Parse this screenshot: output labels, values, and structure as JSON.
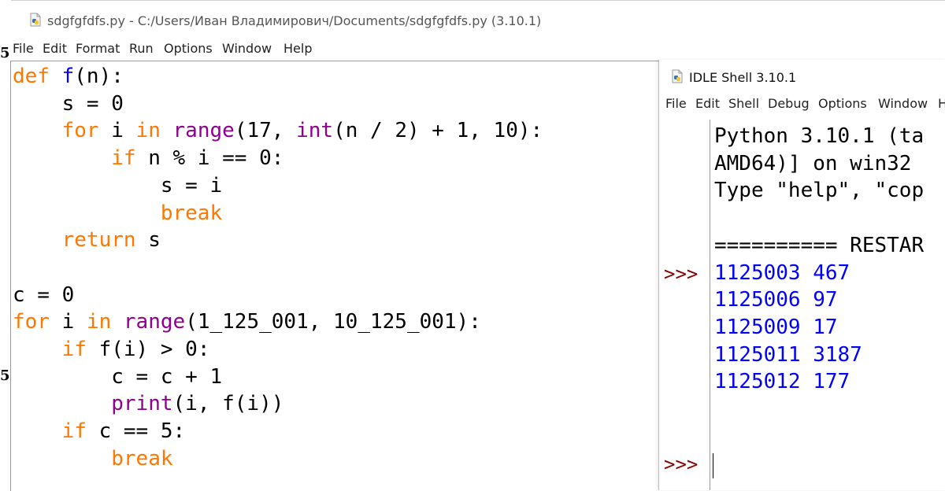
{
  "editor": {
    "title": "sdgfgfdfs.py - C:/Users/Иван Владимирович/Documents/sdgfgfdfs.py (3.10.1)",
    "menu": [
      "File",
      "Edit",
      "Format",
      "Run",
      "Options",
      "Window",
      "Help"
    ],
    "code_lines": [
      [
        {
          "t": "def",
          "c": "kw"
        },
        {
          "t": " "
        },
        {
          "t": "f",
          "c": "df"
        },
        {
          "t": "(n):"
        }
      ],
      [
        {
          "t": "    s = 0"
        }
      ],
      [
        {
          "t": "    "
        },
        {
          "t": "for",
          "c": "kw"
        },
        {
          "t": " i "
        },
        {
          "t": "in",
          "c": "kw"
        },
        {
          "t": " "
        },
        {
          "t": "range",
          "c": "bi"
        },
        {
          "t": "(17, "
        },
        {
          "t": "int",
          "c": "bi"
        },
        {
          "t": "(n / 2) + 1, 10):"
        }
      ],
      [
        {
          "t": "        "
        },
        {
          "t": "if",
          "c": "kw"
        },
        {
          "t": " n % i == 0:"
        }
      ],
      [
        {
          "t": "            s = i"
        }
      ],
      [
        {
          "t": "            "
        },
        {
          "t": "break",
          "c": "kw"
        }
      ],
      [
        {
          "t": "    "
        },
        {
          "t": "return",
          "c": "kw"
        },
        {
          "t": " s"
        }
      ],
      [
        {
          "t": ""
        }
      ],
      [
        {
          "t": "c = 0"
        }
      ],
      [
        {
          "t": "for",
          "c": "kw"
        },
        {
          "t": " i "
        },
        {
          "t": "in",
          "c": "kw"
        },
        {
          "t": " "
        },
        {
          "t": "range",
          "c": "bi"
        },
        {
          "t": "(1_125_001, 10_125_001):"
        }
      ],
      [
        {
          "t": "    "
        },
        {
          "t": "if",
          "c": "kw"
        },
        {
          "t": " f(i) > 0:"
        }
      ],
      [
        {
          "t": "        c = c + 1"
        }
      ],
      [
        {
          "t": "        "
        },
        {
          "t": "print",
          "c": "bi"
        },
        {
          "t": "(i, f(i))"
        }
      ],
      [
        {
          "t": "    "
        },
        {
          "t": "if",
          "c": "kw"
        },
        {
          "t": " c == 5:"
        }
      ],
      [
        {
          "t": "        "
        },
        {
          "t": "break",
          "c": "kw"
        }
      ]
    ],
    "edge_marks": [
      "5",
      "5"
    ]
  },
  "shell": {
    "title": "IDLE Shell 3.10.1",
    "menu": [
      "File",
      "Edit",
      "Shell",
      "Debug",
      "Options",
      "Window",
      "H"
    ],
    "prompt": ">>>",
    "lines": [
      {
        "text": "Python 3.10.1 (ta",
        "style": "plain"
      },
      {
        "text": "AMD64)] on win32",
        "style": "plain"
      },
      {
        "text": "Type \"help\", \"cop",
        "style": "plain"
      },
      {
        "text": "",
        "style": "plain"
      },
      {
        "text": "========== RESTAR",
        "style": "plain"
      },
      {
        "text": "1125003 467",
        "style": "out"
      },
      {
        "text": "1125006 97",
        "style": "out"
      },
      {
        "text": "1125009 17",
        "style": "out"
      },
      {
        "text": "1125011 3187",
        "style": "out"
      },
      {
        "text": "1125012 177",
        "style": "out"
      }
    ]
  },
  "colors": {
    "keyword": "#ff7700",
    "builtin": "#900090",
    "definition": "#0000ff",
    "output": "#0000ff",
    "prompt": "#8b0000"
  },
  "icons": [
    "python-file-icon",
    "python-shell-icon"
  ]
}
